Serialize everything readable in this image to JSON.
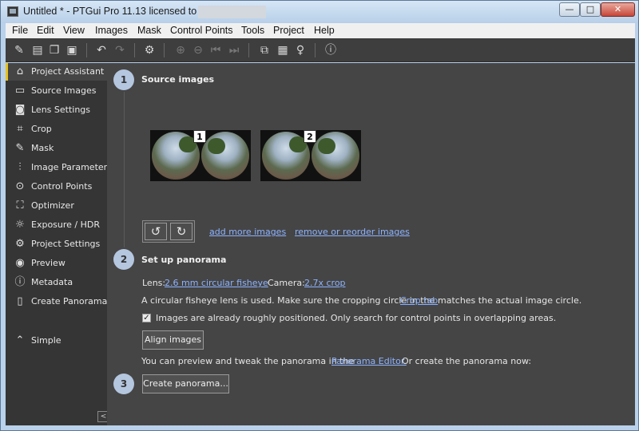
{
  "window": {
    "title": "Untitled * - PTGui Pro 11.13 licensed to",
    "controls": {
      "minimize": "—",
      "maximize": "□",
      "close": "✕"
    }
  },
  "menu": [
    "File",
    "Edit",
    "View",
    "Images",
    "Mask",
    "Control Points",
    "Tools",
    "Project",
    "Help"
  ],
  "toolbar": {
    "icons": [
      "new-project-icon",
      "open-project-icon",
      "open-recent-icon",
      "save-icon",
      "undo-icon",
      "redo-icon",
      "settings-icon",
      "zoom-in-icon",
      "zoom-out-icon",
      "previous-icon",
      "next-icon",
      "panorama-editor-icon",
      "table-icon",
      "lightbulb-icon",
      "help-icon"
    ]
  },
  "sidebar": {
    "items": [
      {
        "label": "Project Assistant",
        "icon": "home-icon",
        "glyph": "⌂",
        "active": true
      },
      {
        "label": "Source Images",
        "icon": "image-icon",
        "glyph": "▭"
      },
      {
        "label": "Lens Settings",
        "icon": "camera-icon",
        "glyph": "◙"
      },
      {
        "label": "Crop",
        "icon": "crop-icon",
        "glyph": "⌗"
      },
      {
        "label": "Mask",
        "icon": "brush-icon",
        "glyph": "✎"
      },
      {
        "label": "Image Parameters",
        "icon": "sliders-icon",
        "glyph": "⫶"
      },
      {
        "label": "Control Points",
        "icon": "pin-icon",
        "glyph": "⊙"
      },
      {
        "label": "Optimizer",
        "icon": "optimizer-icon",
        "glyph": "⛶"
      },
      {
        "label": "Exposure / HDR",
        "icon": "sun-icon",
        "glyph": "☼"
      },
      {
        "label": "Project Settings",
        "icon": "gear-icon",
        "glyph": "⚙"
      },
      {
        "label": "Preview",
        "icon": "eye-icon",
        "glyph": "◉"
      },
      {
        "label": "Metadata",
        "icon": "info-icon",
        "glyph": "ⓘ"
      },
      {
        "label": "Create Panorama",
        "icon": "panorama-icon",
        "glyph": "▯"
      }
    ],
    "simple": {
      "label": "Simple",
      "icon": "chevron-up-icon",
      "glyph": "⌃"
    },
    "collapse_glyph": "<"
  },
  "steps": {
    "s1": {
      "number": "1",
      "title": "Source images"
    },
    "s2": {
      "number": "2",
      "title": "Set up panorama"
    },
    "s3": {
      "number": "3"
    }
  },
  "source_images": {
    "thumbs": [
      {
        "number": "1"
      },
      {
        "number": "2"
      }
    ],
    "rotate_left_glyph": "↺",
    "rotate_right_glyph": "↻",
    "add_more_link": "add more images",
    "remove_reorder_link": "remove or reorder images"
  },
  "setup": {
    "lens_label": "Lens:",
    "lens_value": "2.6 mm circular fisheye",
    "camera_label": "Camera:",
    "camera_value": "2.7x crop",
    "fisheye_text_before": "A circular fisheye lens is used. Make sure the cropping circle in the",
    "crop_tab_link": "Crop tab",
    "fisheye_text_after": "matches the actual image circle.",
    "checkbox_checked": true,
    "checkbox_mark": "✓",
    "checkbox_label": "Images are already roughly positioned. Only search for control points in overlapping areas.",
    "align_button": "Align images",
    "preview_text_before": "You can preview and tweak the panorama in the",
    "editor_link": "Panorama Editor.",
    "preview_text_after": "Or create the panorama now:"
  },
  "create": {
    "button": "Create panorama..."
  }
}
